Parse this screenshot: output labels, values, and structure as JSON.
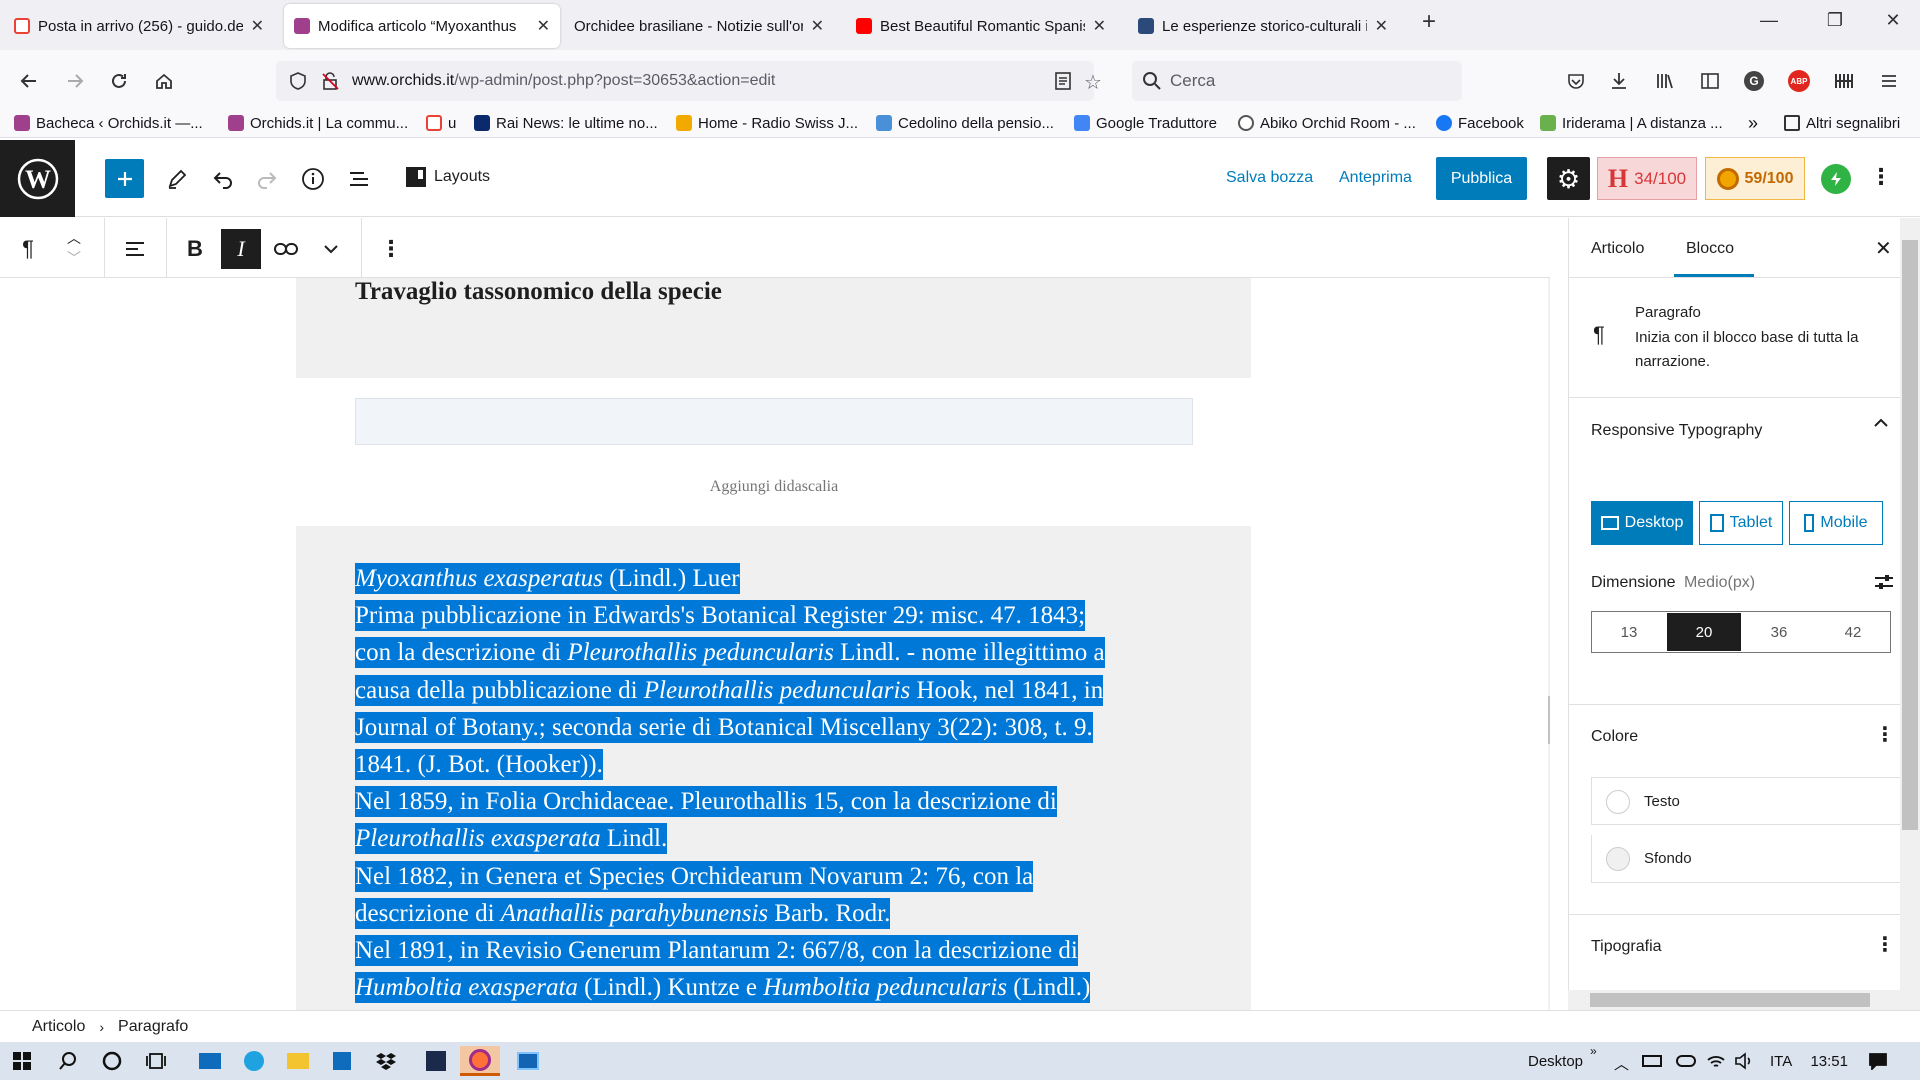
{
  "browser": {
    "tabs": [
      {
        "label": "Posta in arrivo (256) - guido.de",
        "favicon_color": "#ea4335",
        "active": false
      },
      {
        "label": "Modifica articolo “Myoxanthus",
        "favicon_color": "#a03f8c",
        "active": true
      },
      {
        "label": "Orchidee brasiliane - Notizie sull'or",
        "favicon_color": "#ffffff",
        "active": false
      },
      {
        "label": "Best Beautiful Romantic Spanis",
        "favicon_color": "#ff0000",
        "active": false
      },
      {
        "label": "Le esperienze storico-culturali in",
        "favicon_color": "#2b4a7a",
        "active": false
      }
    ],
    "url_domain": "www.orchids.it",
    "url_path": "/wp-admin/post.php?post=30653&action=edit",
    "search_placeholder": "Cerca",
    "bookmarks": [
      {
        "label": "Bacheca ‹ Orchids.it —...",
        "color": "#a03f8c"
      },
      {
        "label": "Orchids.it | La commu...",
        "color": "#a03f8c"
      },
      {
        "label": "u",
        "color": "#ea4335"
      },
      {
        "label": "Rai News: le ultime no...",
        "color": "#0a2a6b"
      },
      {
        "label": "Home - Radio Swiss J...",
        "color": "#f2a900"
      },
      {
        "label": "Cedolino della pensio...",
        "color": "#4a90d9"
      },
      {
        "label": "Google Traduttore",
        "color": "#4285f4"
      },
      {
        "label": "Abiko Orchid Room - ...",
        "color": "#555555"
      },
      {
        "label": "Facebook",
        "color": "#1877f2"
      },
      {
        "label": "Iriderama | A distanza ...",
        "color": "#6ab04c"
      }
    ],
    "bookmarks_other": "Altri segnalibri"
  },
  "wp": {
    "layouts_label": "Layouts",
    "save_draft": "Salva bozza",
    "preview": "Anteprima",
    "publish": "Pubblica",
    "badge_h": "34/100",
    "badge_o": "59/100",
    "heading": "Travaglio tassonomico della specie",
    "caption_placeholder": "Aggiungi didascalia",
    "paragraph_lines": [
      [
        {
          "t": "Myoxanthus exasperatus",
          "i": true
        },
        {
          "t": " (Lindl.) Luer",
          "i": false
        }
      ],
      [
        {
          "t": "Prima pubblicazione in Edwards's Botanical Register 29: misc. 47. 1843;",
          "i": false
        }
      ],
      [
        {
          "t": "con la descrizione di ",
          "i": false
        },
        {
          "t": "Pleurothallis peduncularis",
          "i": true
        },
        {
          "t": " Lindl. - nome illegittimo a",
          "i": false
        }
      ],
      [
        {
          "t": "causa della pubblicazione di ",
          "i": false
        },
        {
          "t": "Pleurothallis peduncularis",
          "i": true
        },
        {
          "t": " Hook, nel 1841, in",
          "i": false
        }
      ],
      [
        {
          "t": "Journal of Botany.; seconda serie di Botanical Miscellany 3(22): 308, t. 9.",
          "i": false
        }
      ],
      [
        {
          "t": "1841. (J. Bot. (Hooker)).",
          "i": false
        }
      ],
      [
        {
          "t": "Nel 1859, in Folia Orchidaceae. Pleurothallis 15, con la descrizione di",
          "i": false
        }
      ],
      [
        {
          "t": "Pleurothallis exasperata",
          "i": true
        },
        {
          "t": " Lindl.",
          "i": false
        }
      ],
      [
        {
          "t": "Nel 1882, in Genera et Species Orchidearum Novarum 2: 76, con la",
          "i": false
        }
      ],
      [
        {
          "t": "descrizione di ",
          "i": false
        },
        {
          "t": "Anathallis parahybunensis",
          "i": true
        },
        {
          "t": " Barb. Rodr.",
          "i": false
        }
      ],
      [
        {
          "t": "Nel 1891, in Revisio Generum Plantarum 2: 667/8, con la descrizione di",
          "i": false
        }
      ],
      [
        {
          "t": "Humboltia exasperata",
          "i": true
        },
        {
          "t": " (Lindl.) Kuntze e ",
          "i": false
        },
        {
          "t": "Humboltia peduncularis",
          "i": true
        },
        {
          "t": " (Lindl.)",
          "i": false
        }
      ]
    ],
    "sidebar": {
      "tab_post": "Articolo",
      "tab_block": "Blocco",
      "block_name": "Paragrafo",
      "block_desc_1": "Inizia con il blocco base di tutta la",
      "block_desc_2": "narrazione.",
      "responsive_typo": "Responsive Typography",
      "devices": [
        "Desktop",
        "Tablet",
        "Mobile"
      ],
      "dimension_label": "Dimensione",
      "dimension_value": "Medio(px)",
      "sizes": [
        "13",
        "20",
        "36",
        "42"
      ],
      "size_selected": "20",
      "color_section": "Colore",
      "color_text": "Testo",
      "color_bg": "Sfondo",
      "typography_section": "Tipografia"
    },
    "breadcrumb": [
      "Articolo",
      "Paragrafo"
    ]
  },
  "taskbar": {
    "desktop_label": "Desktop",
    "lang": "ITA",
    "time": "13:51"
  }
}
